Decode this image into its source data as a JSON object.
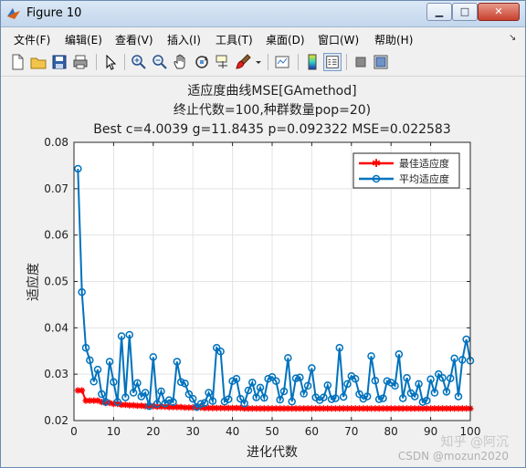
{
  "window": {
    "title": "Figure 10",
    "min_glyph": "▁",
    "max_glyph": "□",
    "close_glyph": "✕"
  },
  "menu": {
    "items": [
      "文件(F)",
      "编辑(E)",
      "查看(V)",
      "插入(I)",
      "工具(T)",
      "桌面(D)",
      "窗口(W)",
      "帮助(H)"
    ]
  },
  "toolbar": {
    "icons": [
      "new-figure-icon",
      "open-file-icon",
      "save-icon",
      "print-icon",
      "select-arrow-icon",
      "zoom-in-icon",
      "zoom-out-icon",
      "pan-hand-icon",
      "rotate-3d-icon",
      "data-cursor-icon",
      "brush-icon",
      "link-plot-icon",
      "colorbar-icon",
      "legend-icon",
      "hide-plot-tools-icon",
      "show-plot-tools-icon"
    ]
  },
  "chart_data": {
    "type": "line",
    "title": [
      "适应度曲线MSE[GAmethod]",
      "终止代数=100,种群数量pop=20)",
      "Best c=4.0039 g=11.8435 p=0.092322 MSE=0.022583"
    ],
    "xlabel": "进化代数",
    "ylabel": "适应度",
    "xlim": [
      0,
      100
    ],
    "ylim": [
      0.02,
      0.08
    ],
    "xticks": [
      "0",
      "10",
      "20",
      "30",
      "40",
      "50",
      "60",
      "70",
      "80",
      "90",
      "100"
    ],
    "yticks": [
      "0.02",
      "0.03",
      "0.04",
      "0.05",
      "0.06",
      "0.07",
      "0.08"
    ],
    "grid": true,
    "legend_position": "top-right",
    "x": [
      1,
      2,
      3,
      4,
      5,
      6,
      7,
      8,
      9,
      10,
      11,
      12,
      13,
      14,
      15,
      16,
      17,
      18,
      19,
      20,
      21,
      22,
      23,
      24,
      25,
      26,
      27,
      28,
      29,
      30,
      31,
      32,
      33,
      34,
      35,
      36,
      37,
      38,
      39,
      40,
      41,
      42,
      43,
      44,
      45,
      46,
      47,
      48,
      49,
      50,
      51,
      52,
      53,
      54,
      55,
      56,
      57,
      58,
      59,
      60,
      61,
      62,
      63,
      64,
      65,
      66,
      67,
      68,
      69,
      70,
      71,
      72,
      73,
      74,
      75,
      76,
      77,
      78,
      79,
      80,
      81,
      82,
      83,
      84,
      85,
      86,
      87,
      88,
      89,
      90,
      91,
      92,
      93,
      94,
      95,
      96,
      97,
      98,
      99,
      100
    ],
    "series": [
      {
        "name": "最佳适应度",
        "color": "#ff0000",
        "marker": "asterisk",
        "values": [
          0.0265,
          0.0265,
          0.0243,
          0.0243,
          0.0243,
          0.0243,
          0.024,
          0.0238,
          0.0238,
          0.0236,
          0.0236,
          0.0234,
          0.0234,
          0.0233,
          0.0233,
          0.0232,
          0.0232,
          0.0231,
          0.0231,
          0.0231,
          0.023,
          0.023,
          0.023,
          0.0229,
          0.0229,
          0.0229,
          0.0229,
          0.0228,
          0.0228,
          0.0228,
          0.0228,
          0.0228,
          0.0227,
          0.0227,
          0.0227,
          0.0227,
          0.0227,
          0.0227,
          0.0227,
          0.0227,
          0.0227,
          0.0227,
          0.0226,
          0.0226,
          0.0226,
          0.0226,
          0.0226,
          0.0226,
          0.0226,
          0.0226,
          0.0226,
          0.0226,
          0.0226,
          0.0226,
          0.0226,
          0.0226,
          0.0226,
          0.0226,
          0.0226,
          0.0226,
          0.0226,
          0.0226,
          0.0226,
          0.0226,
          0.0226,
          0.0226,
          0.0226,
          0.0226,
          0.0226,
          0.0226,
          0.0226,
          0.0226,
          0.0226,
          0.0226,
          0.0226,
          0.0226,
          0.0226,
          0.0226,
          0.0226,
          0.0226,
          0.0226,
          0.0226,
          0.0226,
          0.0226,
          0.0226,
          0.0226,
          0.0226,
          0.0226,
          0.0226,
          0.0226,
          0.0226,
          0.0226,
          0.0226,
          0.0226,
          0.0226,
          0.0226,
          0.0226,
          0.0226,
          0.0226,
          0.0226
        ]
      },
      {
        "name": "平均适应度",
        "color": "#0072bd",
        "marker": "circle",
        "values": [
          0.0743,
          0.0477,
          0.0357,
          0.033,
          0.0284,
          0.031,
          0.0257,
          0.024,
          0.0327,
          0.0283,
          0.024,
          0.0382,
          0.025,
          0.0385,
          0.026,
          0.0281,
          0.0252,
          0.026,
          0.0231,
          0.0337,
          0.0236,
          0.0263,
          0.0237,
          0.0244,
          0.024,
          0.0327,
          0.0283,
          0.028,
          0.0257,
          0.0247,
          0.0229,
          0.0236,
          0.0238,
          0.026,
          0.0242,
          0.0357,
          0.0349,
          0.0241,
          0.0246,
          0.0285,
          0.029,
          0.0247,
          0.0237,
          0.0265,
          0.0282,
          0.025,
          0.0271,
          0.0249,
          0.029,
          0.0294,
          0.0285,
          0.0245,
          0.0263,
          0.0335,
          0.0241,
          0.0291,
          0.0293,
          0.0258,
          0.0275,
          0.0313,
          0.025,
          0.0244,
          0.025,
          0.0276,
          0.0246,
          0.0248,
          0.0357,
          0.0251,
          0.0279,
          0.0296,
          0.029,
          0.0257,
          0.0247,
          0.0252,
          0.0339,
          0.0286,
          0.0246,
          0.0248,
          0.0285,
          0.0282,
          0.0275,
          0.0343,
          0.0248,
          0.0292,
          0.0259,
          0.0252,
          0.0279,
          0.024,
          0.0243,
          0.0289,
          0.026,
          0.03,
          0.0292,
          0.0262,
          0.0291,
          0.0334,
          0.0252,
          0.0331,
          0.0375,
          0.0329
        ]
      }
    ]
  },
  "watermark": "知乎 @阿沉",
  "watermark2": "CSDN @mozun2020"
}
